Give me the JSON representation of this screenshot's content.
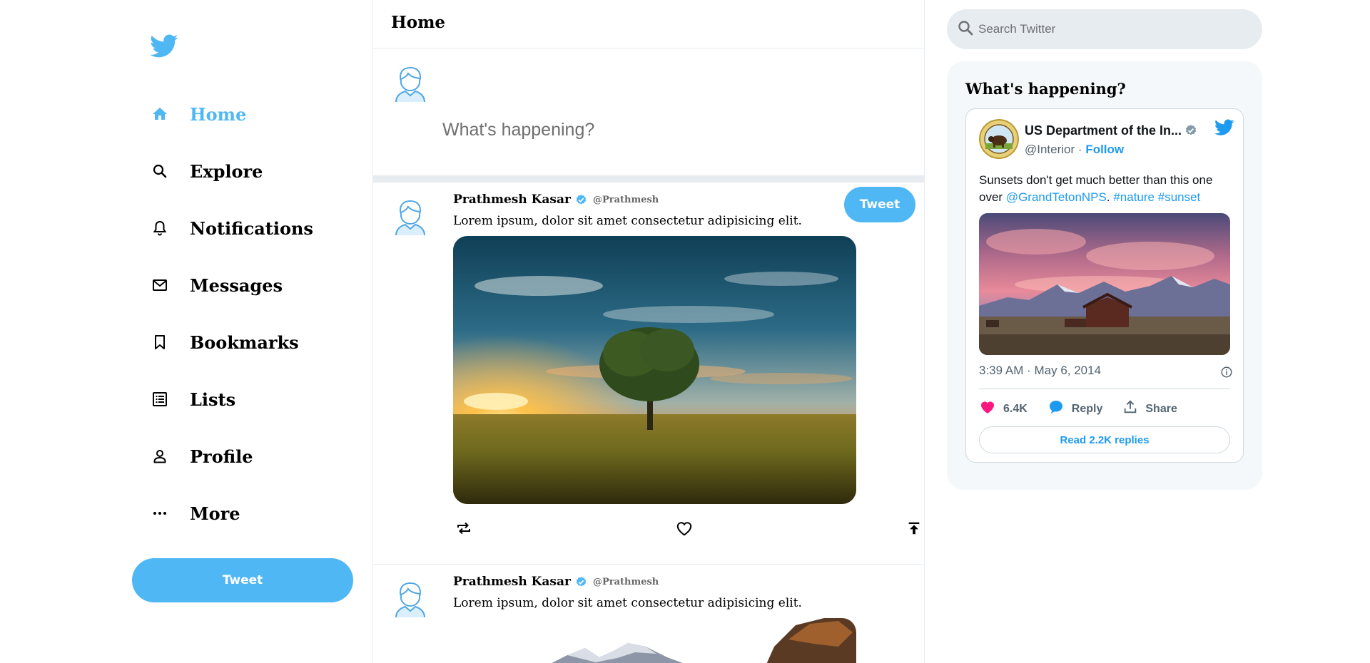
{
  "sidebar": {
    "logo_icon": "twitter-bird-icon",
    "accent_color": "#50b7f5",
    "items": [
      {
        "label": "Home",
        "icon": "home-icon",
        "active": true
      },
      {
        "label": "Explore",
        "icon": "search-icon"
      },
      {
        "label": "Notifications",
        "icon": "bell-icon"
      },
      {
        "label": "Messages",
        "icon": "mail-icon"
      },
      {
        "label": "Bookmarks",
        "icon": "bookmark-icon"
      },
      {
        "label": "Lists",
        "icon": "list-icon"
      },
      {
        "label": "Profile",
        "icon": "person-icon"
      },
      {
        "label": "More",
        "icon": "more-icon"
      }
    ],
    "tweet_label": "Tweet"
  },
  "feed": {
    "title": "Home",
    "compose": {
      "placeholder": "What's happening?",
      "tweet_label": "Tweet"
    },
    "posts": [
      {
        "name": "Prathmesh Kasar",
        "handle": "@Prathmesh",
        "text": "Lorem ipsum, dolor sit amet consectetur adipisicing elit.",
        "image": "tree-sunset-photo"
      },
      {
        "name": "Prathmesh Kasar",
        "handle": "@Prathmesh",
        "text": "Lorem ipsum, dolor sit amet consectetur adipisicing elit.",
        "image": "mountains-photo"
      }
    ]
  },
  "search": {
    "placeholder": "Search Twitter"
  },
  "widget": {
    "title": "What's happening?",
    "embed": {
      "account_name": "US Department of the In...",
      "handle": "@Interior",
      "separator": "·",
      "follow_label": "Follow",
      "text_prefix": "Sunsets don't get much better than this one over",
      "mention": "@GrandTetonNPS",
      "hashtag1": "#nature",
      "hashtag2": "#sunset",
      "period": ".",
      "timestamp": "3:39 AM · May 6, 2014",
      "likes": "6.4K",
      "reply_label": "Reply",
      "share_label": "Share",
      "read_replies_label": "Read 2.2K replies"
    }
  }
}
